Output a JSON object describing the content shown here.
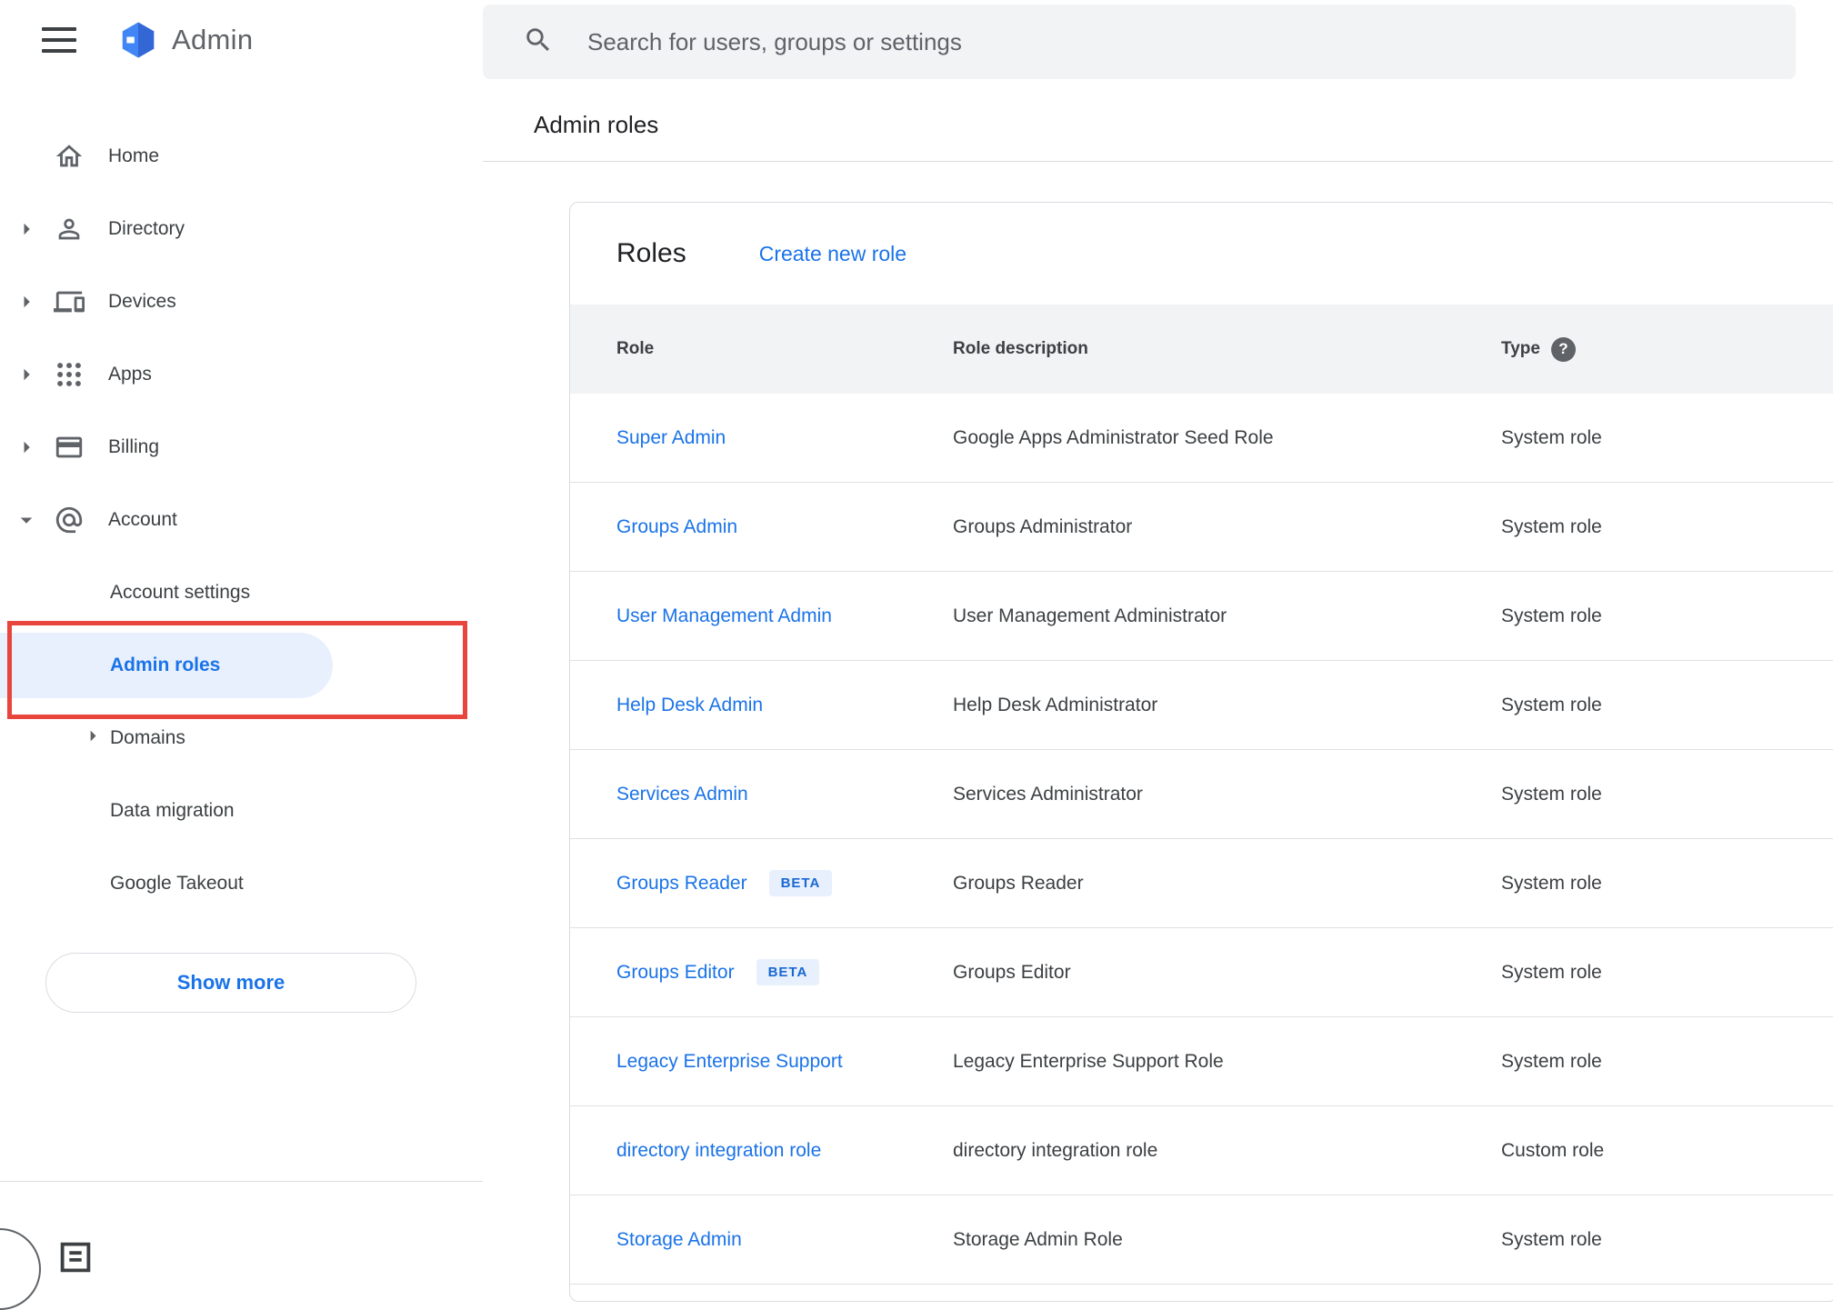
{
  "app": {
    "title": "Admin",
    "search_placeholder": "Search for users, groups or settings",
    "breadcrumb": "Admin roles"
  },
  "sidebar": {
    "items": [
      {
        "label": "Home",
        "icon": "home-icon",
        "expandable": false
      },
      {
        "label": "Directory",
        "icon": "person-icon",
        "expandable": true
      },
      {
        "label": "Devices",
        "icon": "devices-icon",
        "expandable": true
      },
      {
        "label": "Apps",
        "icon": "apps-grid-icon",
        "expandable": true
      },
      {
        "label": "Billing",
        "icon": "credit-card-icon",
        "expandable": true
      },
      {
        "label": "Account",
        "icon": "at-sign-icon",
        "expandable": true,
        "expanded": true
      }
    ],
    "account_children": [
      {
        "label": "Account settings",
        "selected": false
      },
      {
        "label": "Admin roles",
        "selected": true
      },
      {
        "label": "Domains",
        "selected": false,
        "expandable": true
      },
      {
        "label": "Data migration",
        "selected": false
      },
      {
        "label": "Google Takeout",
        "selected": false
      }
    ],
    "show_more_label": "Show more"
  },
  "annotation": {
    "type": "red-rectangle",
    "target": "Admin roles",
    "color": "#e8453c"
  },
  "main": {
    "card_title": "Roles",
    "create_link": "Create new role",
    "table": {
      "columns": [
        "Role",
        "Role description",
        "Type"
      ],
      "beta_label": "BETA",
      "help_glyph": "?",
      "rows": [
        {
          "role": "Super Admin",
          "beta": false,
          "description": "Google Apps Administrator Seed Role",
          "type": "System role"
        },
        {
          "role": "Groups Admin",
          "beta": false,
          "description": "Groups Administrator",
          "type": "System role"
        },
        {
          "role": "User Management Admin",
          "beta": false,
          "description": "User Management Administrator",
          "type": "System role"
        },
        {
          "role": "Help Desk Admin",
          "beta": false,
          "description": "Help Desk Administrator",
          "type": "System role"
        },
        {
          "role": "Services Admin",
          "beta": false,
          "description": "Services Administrator",
          "type": "System role"
        },
        {
          "role": "Groups Reader",
          "beta": true,
          "description": "Groups Reader",
          "type": "System role"
        },
        {
          "role": "Groups Editor",
          "beta": true,
          "description": "Groups Editor",
          "type": "System role"
        },
        {
          "role": "Legacy Enterprise Support",
          "beta": false,
          "description": "Legacy Enterprise Support Role",
          "type": "System role"
        },
        {
          "role": "directory integration role",
          "beta": false,
          "description": "directory integration role",
          "type": "Custom role"
        },
        {
          "role": "Storage Admin",
          "beta": false,
          "description": "Storage Admin Role",
          "type": "System role"
        }
      ]
    }
  },
  "colors": {
    "link_blue": "#1a73e8",
    "selected_bg": "#e8f0fe",
    "selected_text": "#1a73e8",
    "annotation_red": "#e8453c",
    "table_header_bg": "#f1f3f4",
    "search_bg": "#f1f3f4",
    "beta_bg": "#e8f0fe",
    "beta_text": "#1967d2",
    "text_primary": "#202124",
    "text_secondary": "#5f6368"
  }
}
